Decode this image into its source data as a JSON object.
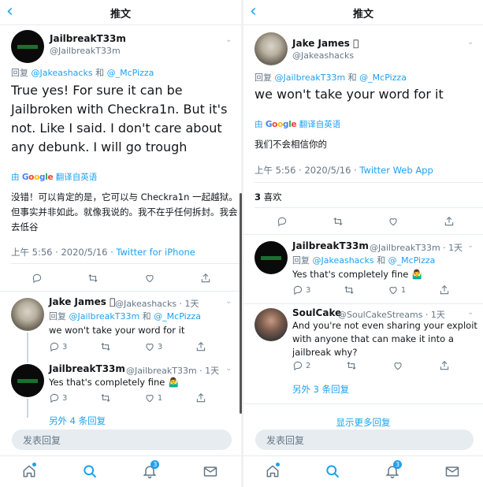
{
  "left": {
    "header": {
      "title": "推文"
    },
    "main_tweet": {
      "name": "JailbreakT33m",
      "handle": "@JailbreakT33m",
      "reply_prefix": "回复",
      "reply_user1": "@Jakeashacks",
      "reply_and": "和",
      "reply_user2": "@_McPizza",
      "text": "True yes! For sure it can be Jailbroken with Checkra1n. But it's not. Like I said. I don't care about any debunk. I will go trough",
      "translate_prefix": "由",
      "translate_suffix": "翻译自英语",
      "translation": "没错！可以肯定的是，它可以与 Checkra1n 一起越狱。但事实并非如此。就像我说的。我不在乎任何拆封。我会去低谷",
      "time": "上午 5:56 · 2020/5/16 ·",
      "source": "Twitter for iPhone"
    },
    "replies": [
      {
        "name": "Jake James ",
        "handle": "@Jakeashacks · 1天",
        "reply_prefix": "回复",
        "reply_user1": "@JailbreakT33m",
        "reply_and": "和",
        "reply_user2": "@_McPizza",
        "text": "we won't take your word for it",
        "reply_count": "3",
        "like_count": "3"
      },
      {
        "name": "JailbreakT33m",
        "handle": "@JailbreakT33m · 1天",
        "text": "Yes that's completely fine 🤷‍♂️",
        "reply_count": "3",
        "like_count": "1"
      }
    ],
    "more_replies": "另外 4 条回复",
    "composer_placeholder": "发表回复",
    "tabs": {
      "notifications_badge": "3"
    }
  },
  "right": {
    "header": {
      "title": "推文"
    },
    "main_tweet": {
      "name": "Jake James ",
      "handle": "@Jakeashacks",
      "reply_prefix": "回复",
      "reply_user1": "@JailbreakT33m",
      "reply_and": "和",
      "reply_user2": "@_McPizza",
      "text": "we won't take your word for it",
      "translate_prefix": "由",
      "translate_suffix": "翻译自英语",
      "translation": "我们不会相信你的",
      "time": "上午 5:56 · 2020/5/16 ·",
      "source": "Twitter Web App",
      "likes_count": "3",
      "likes_label": "喜欢"
    },
    "replies": [
      {
        "name": "JailbreakT33m",
        "handle": "@JailbreakT33m · 1天",
        "reply_prefix": "回复",
        "reply_user1": "@Jakeashacks",
        "reply_and": "和",
        "reply_user2": "@_McPizza",
        "text": "Yes that's completely fine 🤷‍♂️",
        "reply_count": "3",
        "like_count": "1"
      },
      {
        "name": "SoulCake",
        "handle": "@SoulCakeStreams · 1天",
        "text": "And you're not even sharing your exploit with anyone that can make it into a jailbreak why?",
        "reply_count": "2",
        "like_count": ""
      }
    ],
    "more_replies": "另外 3 条回复",
    "show_more": "显示更多回复",
    "composer_placeholder": "发表回复",
    "tabs": {
      "notifications_badge": "3"
    }
  }
}
